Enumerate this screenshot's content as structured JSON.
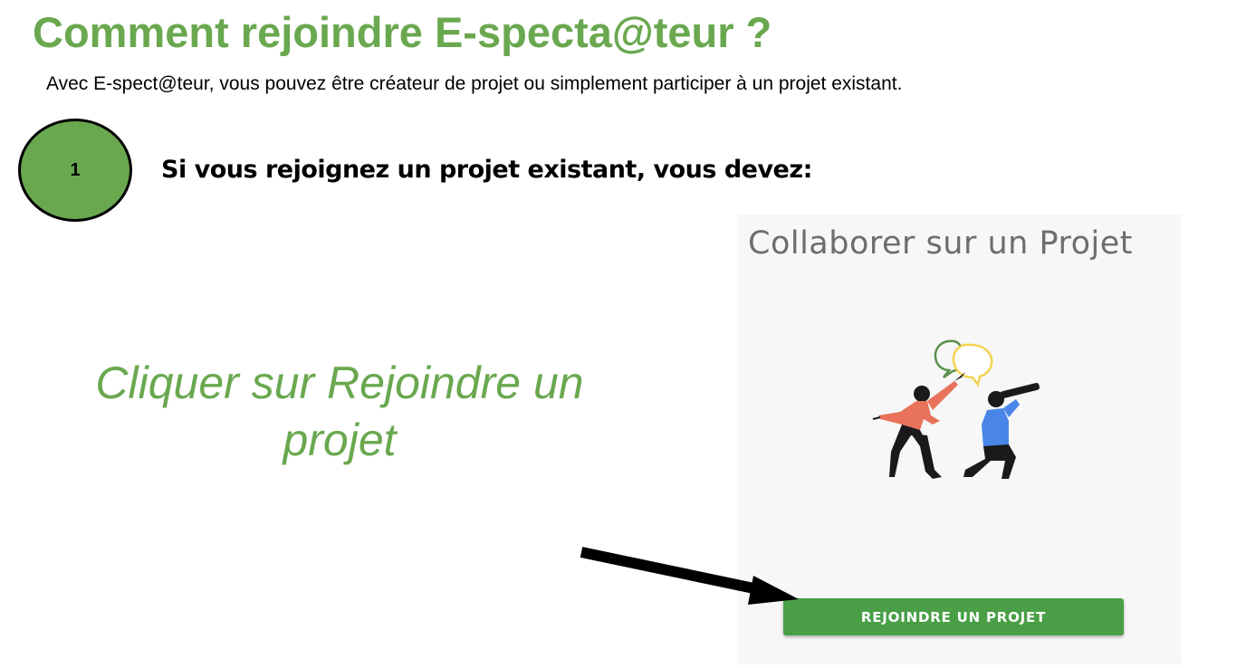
{
  "header": {
    "title": "Comment rejoindre E-specta@teur ?",
    "intro": "Avec E-spect@teur, vous pouvez être créateur de projet ou simplement participer à un projet existant."
  },
  "step": {
    "number": "1",
    "heading": "Si vous rejoignez un projet existant, vous devez:",
    "instruction": "Cliquer sur Rejoindre un projet"
  },
  "card": {
    "title": "Collaborer sur un Projet",
    "button_label": "REJOINDRE UN PROJET"
  },
  "colors": {
    "accent_green": "#6aa84f",
    "button_green": "#4a9f46"
  }
}
